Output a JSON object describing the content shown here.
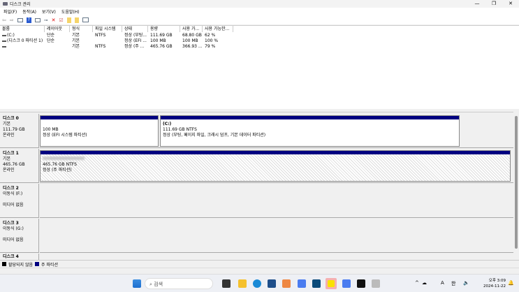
{
  "window": {
    "title": "디스크 관리",
    "controls": [
      "—",
      "❐",
      "✕"
    ]
  },
  "menu": [
    "파일(F)",
    "동작(A)",
    "보기(V)",
    "도움말(H)"
  ],
  "toolbar_icons": [
    "back-icon",
    "forward-icon",
    "console-icon",
    "help-icon",
    "properties-icon",
    "connect-icon",
    "delete-icon",
    "check-icon",
    "import-icon",
    "search-icon",
    "window-icon"
  ],
  "volume_table": {
    "headers": [
      "볼륨",
      "레이아웃",
      "형식",
      "파일 시스템",
      "상태",
      "용량",
      "사용 가...",
      "사용 가능한..."
    ],
    "rows": [
      [
        "(C:)",
        "단순",
        "기본",
        "NTFS",
        "정상 (부팅...",
        "111.69 GB",
        "68.80 GB",
        "62 %"
      ],
      [
        "(디스크 0 파티션 1)",
        "단순",
        "기본",
        "",
        "정상 (EFI ...",
        "100 MB",
        "100 MB",
        "100 %"
      ],
      [
        "",
        "",
        "기본",
        "NTFS",
        "정상 (주 ...",
        "465.76 GB",
        "366.93 ...",
        "79 %"
      ]
    ]
  },
  "disks": [
    {
      "name": "디스크 0",
      "type": "기본",
      "size": "111.79 GB",
      "status": "온라인",
      "partitions": [
        {
          "label": "",
          "size": "100 MB",
          "status": "정상 (EFI 시스템 파티션)"
        },
        {
          "label": "(C:)",
          "size": "111.69 GB NTFS",
          "status": "정상 (부팅, 페이지 파일, 크래시 덤프, 기본 데이터 파티션)"
        }
      ]
    },
    {
      "name": "디스크 1",
      "type": "기본",
      "size": "465.76 GB",
      "status": "온라인",
      "partitions": [
        {
          "label": "",
          "size": "465.76 GB NTFS",
          "status": "정상 (주 파티션)"
        }
      ]
    },
    {
      "name": "디스크 2",
      "type": "이동식 (F:)",
      "status": "미디어 없음"
    },
    {
      "name": "디스크 3",
      "type": "이동식 (G:)",
      "status": "미디어 없음"
    },
    {
      "name": "디스크 4"
    }
  ],
  "legend": [
    {
      "label": "할당되지 않음",
      "color": "#000000"
    },
    {
      "label": "주 파티션",
      "color": "#000080"
    }
  ],
  "taskbar": {
    "search_placeholder": "검색",
    "tray": {
      "ampm_time": "오후 3:09",
      "date": "2024-11-22",
      "ime": "한",
      "lang": "A"
    }
  }
}
